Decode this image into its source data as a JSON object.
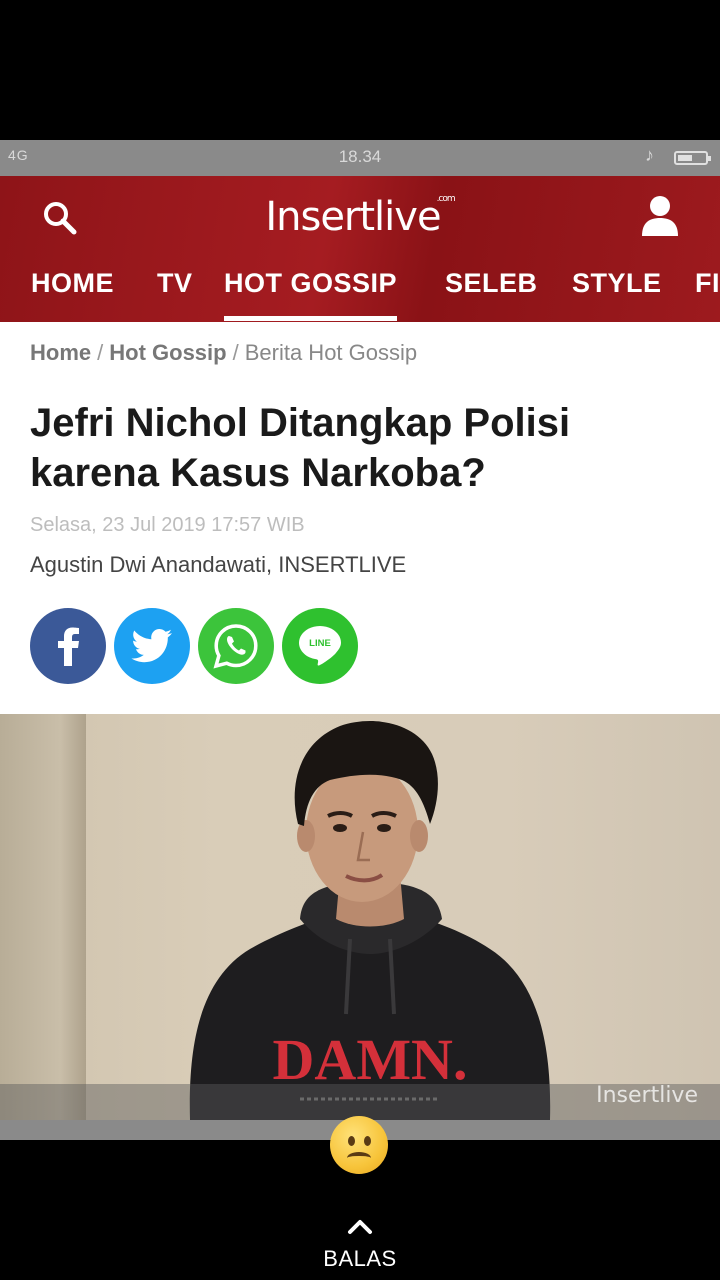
{
  "status_bar": {
    "signal": "4G",
    "time": "18.34"
  },
  "header": {
    "logo_main": "Insertlive",
    "logo_sup": ".com",
    "nav": [
      "HOME",
      "TV",
      "HOT GOSSIP",
      "SELEB",
      "STYLE",
      "FI"
    ],
    "active_nav": "HOT GOSSIP"
  },
  "breadcrumb": {
    "home": "Home",
    "section": "Hot Gossip",
    "current": "Berita Hot Gossip",
    "separator": "/"
  },
  "article": {
    "title": "Jefri Nichol Ditangkap Polisi karena Kasus Narkoba?",
    "date": "Selasa, 23 Jul 2019 17:57 WIB",
    "author": "Agustin Dwi Anandawati, INSERTLIVE"
  },
  "share": {
    "facebook_color": "#3b5998",
    "twitter_color": "#1da1f2",
    "whatsapp_color": "#3cc43b",
    "line_color": "#2fc12f",
    "line_label": "LINE"
  },
  "photo": {
    "shirt_text": "DAMN.",
    "watermark": "Insertlive"
  },
  "reply": {
    "label": "BALAS"
  }
}
